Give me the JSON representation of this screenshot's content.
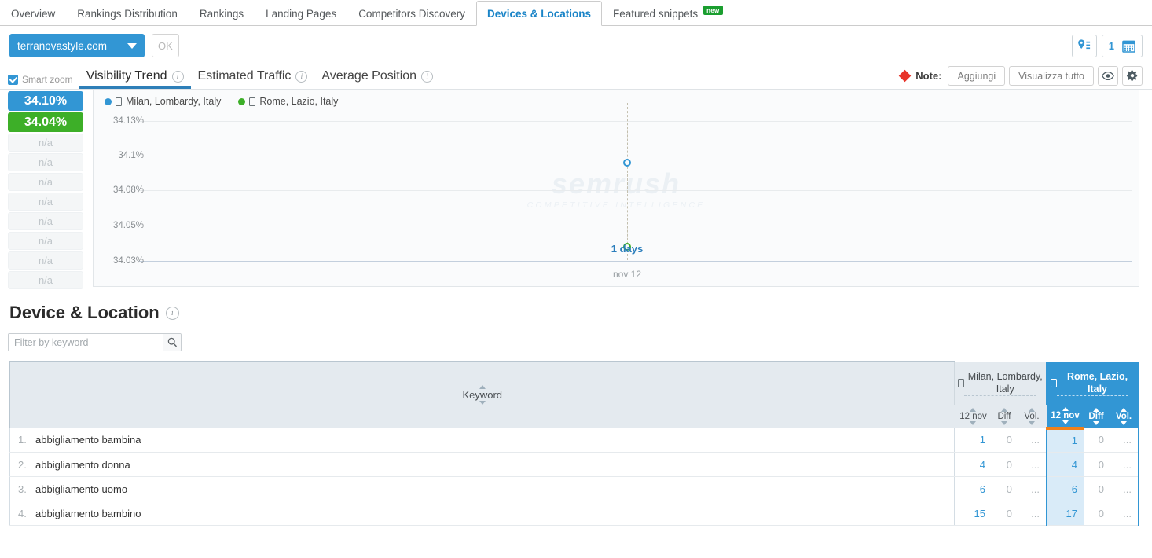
{
  "tabs": [
    {
      "label": "Overview",
      "active": false
    },
    {
      "label": "Rankings Distribution",
      "active": false
    },
    {
      "label": "Rankings",
      "active": false
    },
    {
      "label": "Landing Pages",
      "active": false
    },
    {
      "label": "Competitors Discovery",
      "active": false
    },
    {
      "label": "Devices & Locations",
      "active": true
    },
    {
      "label": "Featured snippets",
      "active": false,
      "badge": "new"
    }
  ],
  "toolbar": {
    "domain": "terranovastyle.com",
    "ok_label": "OK",
    "date_count": "1"
  },
  "subtoolbar": {
    "smart_zoom_label": "Smart zoom",
    "subtabs": [
      {
        "label": "Visibility Trend",
        "active": true
      },
      {
        "label": "Estimated Traffic",
        "active": false
      },
      {
        "label": "Average Position",
        "active": false
      }
    ],
    "note_label": "Note:",
    "add_label": "Aggiungi",
    "view_all_label": "Visualizza tutto"
  },
  "visibility_panel": {
    "values": [
      "34.10%",
      "34.04%"
    ],
    "na_label": "n/a",
    "na_count": 8
  },
  "watermark": {
    "main": "semrush",
    "sub": "COMPETITIVE INTELLIGENCE"
  },
  "chart_data": {
    "type": "line",
    "title": "Visibility Trend",
    "xlabel": "",
    "ylabel": "",
    "ylim": [
      34.03,
      34.13
    ],
    "y_ticks": [
      "34.13%",
      "34.1%",
      "34.08%",
      "34.05%",
      "34.03%"
    ],
    "x": [
      "nov 12"
    ],
    "annotation": "1 days",
    "legend_position": "top-left",
    "grid": true,
    "series": [
      {
        "name": "Milan, Lombardy, Italy",
        "color": "#3296d4",
        "values": [
          34.1
        ]
      },
      {
        "name": "Rome, Lazio, Italy",
        "color": "#3daf28",
        "values": [
          34.04
        ]
      }
    ]
  },
  "section": {
    "title": "Device & Location",
    "filter_placeholder": "Filter by keyword"
  },
  "table": {
    "keyword_header": "Keyword",
    "groups": [
      {
        "label": "Milan, Lombardy, Italy",
        "selected": false,
        "cols": [
          {
            "label": "12 nov",
            "sorted": false
          },
          {
            "label": "Diff",
            "sorted": false
          },
          {
            "label": "Vol.",
            "sorted": false
          }
        ]
      },
      {
        "label": "Rome, Lazio, Italy",
        "selected": true,
        "cols": [
          {
            "label": "12 nov",
            "sorted": true
          },
          {
            "label": "Diff",
            "sorted": false
          },
          {
            "label": "Vol.",
            "sorted": false
          }
        ]
      }
    ],
    "rows": [
      {
        "num": "1.",
        "keyword": "abbigliamento bambina",
        "milan": {
          "pos": "1",
          "diff": "0",
          "vol": "..."
        },
        "rome": {
          "pos": "1",
          "diff": "0",
          "vol": "..."
        }
      },
      {
        "num": "2.",
        "keyword": "abbigliamento donna",
        "milan": {
          "pos": "4",
          "diff": "0",
          "vol": "..."
        },
        "rome": {
          "pos": "4",
          "diff": "0",
          "vol": "..."
        }
      },
      {
        "num": "3.",
        "keyword": "abbigliamento uomo",
        "milan": {
          "pos": "6",
          "diff": "0",
          "vol": "..."
        },
        "rome": {
          "pos": "6",
          "diff": "0",
          "vol": "..."
        }
      },
      {
        "num": "4.",
        "keyword": "abbigliamento bambino",
        "milan": {
          "pos": "15",
          "diff": "0",
          "vol": "..."
        },
        "rome": {
          "pos": "17",
          "diff": "0",
          "vol": "..."
        }
      }
    ]
  },
  "colors": {
    "accent_blue": "#3296d4",
    "accent_green": "#3daf28",
    "sort_orange": "#f08019",
    "note_red": "#e8342a"
  }
}
